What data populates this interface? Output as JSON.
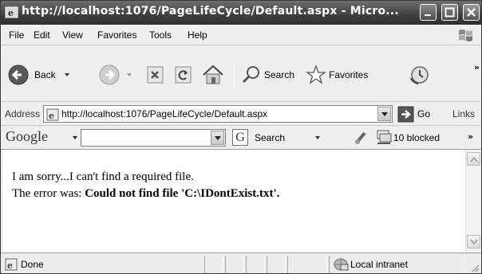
{
  "window": {
    "title": "http://localhost:1076/PageLifeCycle/Default.aspx - Micro...",
    "minimize_icon": "minimize-icon",
    "maximize_icon": "maximize-icon",
    "close_icon": "close-icon"
  },
  "menu": {
    "items": [
      {
        "label": "File"
      },
      {
        "label": "Edit"
      },
      {
        "label": "View"
      },
      {
        "label": "Favorites"
      },
      {
        "label": "Tools"
      },
      {
        "label": "Help"
      }
    ]
  },
  "toolbar": {
    "back_label": "Back",
    "search_label": "Search",
    "favorites_label": "Favorites",
    "more": "»"
  },
  "address": {
    "label": "Address",
    "url": "http://localhost:1076/PageLifeCycle/Default.aspx",
    "go_label": "Go",
    "links_label": "Links"
  },
  "google": {
    "logo": "Google",
    "query": "",
    "search_label": "Search",
    "blocked_label": "10 blocked",
    "more": "»"
  },
  "page": {
    "line1": "I am sorry...I can't find a required file.",
    "line2_prefix": "The error was: ",
    "line2_error": "Could not find file 'C:\\IDontExist.txt'."
  },
  "status": {
    "text": "Done",
    "zone": "Local intranet"
  },
  "colors": {
    "title_bar": "#3e3e3e",
    "chrome": "#efefef",
    "page_bg": "#ffffff"
  }
}
